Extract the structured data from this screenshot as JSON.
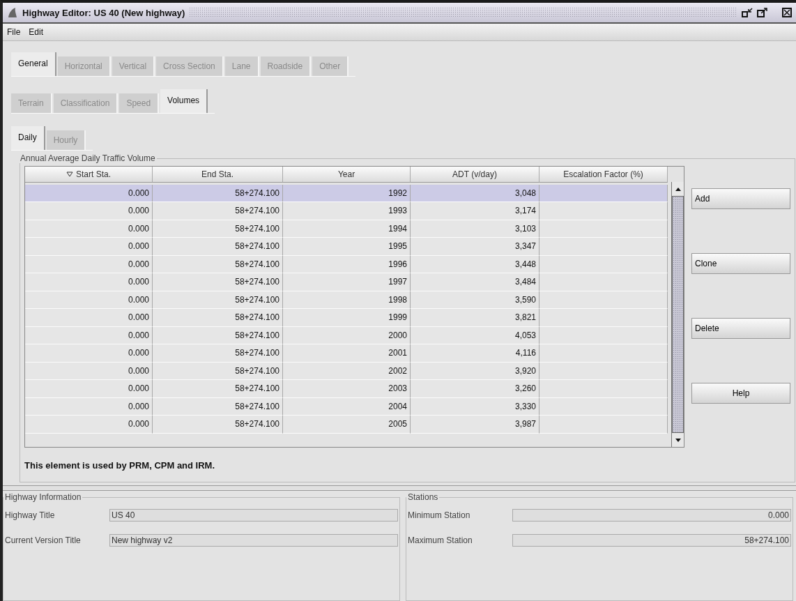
{
  "window": {
    "title": "Highway Editor: US 40 (New highway)"
  },
  "menu": [
    {
      "label": "File"
    },
    {
      "label": "Edit"
    }
  ],
  "main_tabs": [
    {
      "label": "General",
      "selected": true
    },
    {
      "label": "Horizontal",
      "selected": false
    },
    {
      "label": "Vertical",
      "selected": false
    },
    {
      "label": "Cross Section",
      "selected": false
    },
    {
      "label": "Lane",
      "selected": false
    },
    {
      "label": "Roadside",
      "selected": false
    },
    {
      "label": "Other",
      "selected": false
    }
  ],
  "sub_tabs": [
    {
      "label": "Terrain",
      "selected": false
    },
    {
      "label": "Classification",
      "selected": false
    },
    {
      "label": "Speed",
      "selected": false
    },
    {
      "label": "Volumes",
      "selected": true
    }
  ],
  "volume_tabs": [
    {
      "label": "Daily",
      "selected": true
    },
    {
      "label": "Hourly",
      "selected": false
    }
  ],
  "volume_group": {
    "title": "Annual Average Daily Traffic Volume",
    "table": {
      "columns": [
        {
          "label": "Start Sta.",
          "sorted": true
        },
        {
          "label": "End Sta.",
          "sorted": false
        },
        {
          "label": "Year",
          "sorted": false
        },
        {
          "label": "ADT (v/day)",
          "sorted": false
        },
        {
          "label": "Escalation Factor (%)",
          "sorted": false
        }
      ],
      "rows": [
        {
          "selected": true,
          "cells": [
            "0.000",
            "58+274.100",
            "1992",
            "3,048",
            ""
          ]
        },
        {
          "selected": false,
          "cells": [
            "0.000",
            "58+274.100",
            "1993",
            "3,174",
            ""
          ]
        },
        {
          "selected": false,
          "cells": [
            "0.000",
            "58+274.100",
            "1994",
            "3,103",
            ""
          ]
        },
        {
          "selected": false,
          "cells": [
            "0.000",
            "58+274.100",
            "1995",
            "3,347",
            ""
          ]
        },
        {
          "selected": false,
          "cells": [
            "0.000",
            "58+274.100",
            "1996",
            "3,448",
            ""
          ]
        },
        {
          "selected": false,
          "cells": [
            "0.000",
            "58+274.100",
            "1997",
            "3,484",
            ""
          ]
        },
        {
          "selected": false,
          "cells": [
            "0.000",
            "58+274.100",
            "1998",
            "3,590",
            ""
          ]
        },
        {
          "selected": false,
          "cells": [
            "0.000",
            "58+274.100",
            "1999",
            "3,821",
            ""
          ]
        },
        {
          "selected": false,
          "cells": [
            "0.000",
            "58+274.100",
            "2000",
            "4,053",
            ""
          ]
        },
        {
          "selected": false,
          "cells": [
            "0.000",
            "58+274.100",
            "2001",
            "4,116",
            ""
          ]
        },
        {
          "selected": false,
          "cells": [
            "0.000",
            "58+274.100",
            "2002",
            "3,920",
            ""
          ]
        },
        {
          "selected": false,
          "cells": [
            "0.000",
            "58+274.100",
            "2003",
            "3,260",
            ""
          ]
        },
        {
          "selected": false,
          "cells": [
            "0.000",
            "58+274.100",
            "2004",
            "3,330",
            ""
          ]
        },
        {
          "selected": false,
          "cells": [
            "0.000",
            "58+274.100",
            "2005",
            "3,987",
            ""
          ]
        }
      ]
    },
    "buttons": [
      "Add",
      "Clone",
      "Delete",
      "Help"
    ],
    "note": "This element is used by PRM, CPM and IRM."
  },
  "highway_information": {
    "title": "Highway Information",
    "fields": [
      {
        "label": "Highway Title",
        "value": "US 40"
      },
      {
        "label": "Current Version Title",
        "value": "New highway v2"
      }
    ]
  },
  "stations": {
    "title": "Stations",
    "fields": [
      {
        "label": "Minimum Station",
        "value": "0.000"
      },
      {
        "label": "Maximum Station",
        "value": "58+274.100"
      }
    ]
  }
}
